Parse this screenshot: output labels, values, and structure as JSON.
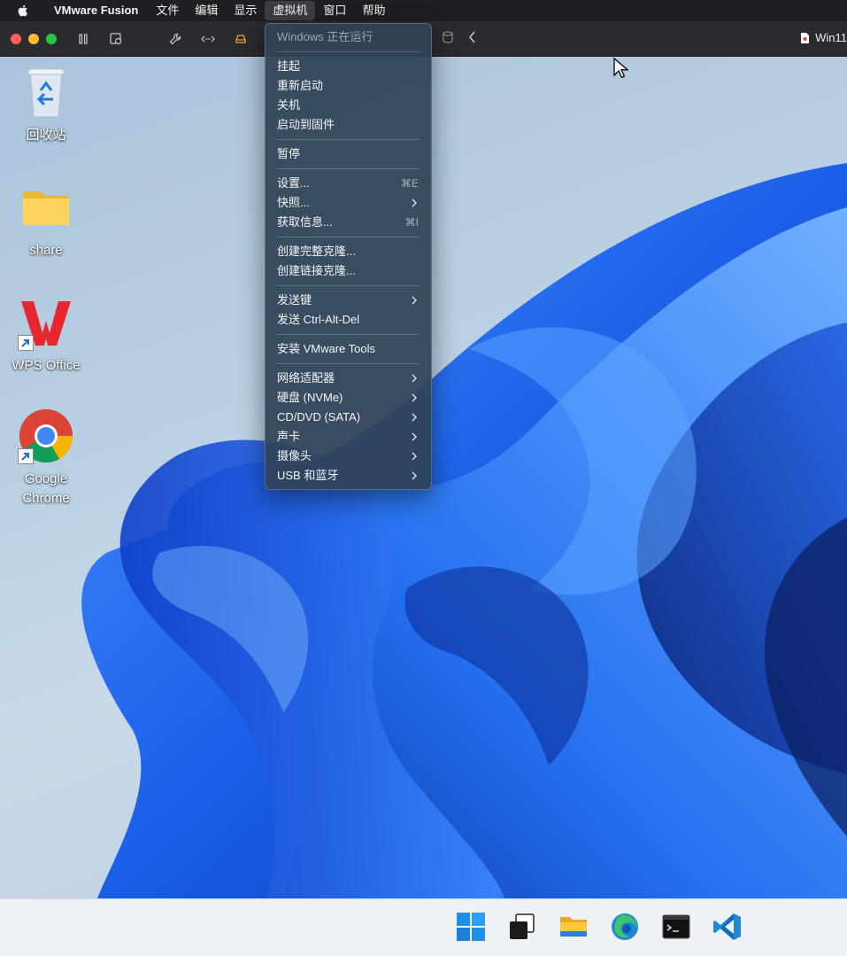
{
  "menubar": {
    "app_name": "VMware Fusion",
    "items": [
      "文件",
      "编辑",
      "显示",
      "虚拟机",
      "窗口",
      "帮助"
    ]
  },
  "toolbar": {
    "vm_title": "Win11"
  },
  "desktop": {
    "icons": [
      {
        "label": "回收站"
      },
      {
        "label": "share"
      },
      {
        "label": "WPS Office"
      },
      {
        "label_line1": "Google",
        "label_line2": "Chrome"
      }
    ]
  },
  "vm_menu": {
    "status": "Windows 正在运行",
    "suspend": "挂起",
    "restart": "重新启动",
    "shutdown": "关机",
    "boot_firmware": "启动到固件",
    "pause": "暂停",
    "settings": "设置...",
    "settings_shortcut": "⌘E",
    "snapshots": "快照...",
    "get_info": "获取信息...",
    "get_info_shortcut": "⌘I",
    "full_clone": "创建完整克隆...",
    "linked_clone": "创建链接克隆...",
    "send_key": "发送键",
    "send_cad": "发送 Ctrl-Alt-Del",
    "install_tools": "安装 VMware Tools",
    "network_adapter": "网络适配器",
    "hard_disk": "硬盘 (NVMe)",
    "cd_dvd": "CD/DVD (SATA)",
    "sound_card": "声卡",
    "camera": "摄像头",
    "usb_bluetooth": "USB 和蓝牙"
  },
  "colors": {
    "menubar_bg": "#1e1f22",
    "toolbar_bg": "#2a2b2e",
    "menu_bg": "#2f4356",
    "bloom_blue": "#1a5fe8",
    "taskbar_bg": "#eef1f5"
  }
}
